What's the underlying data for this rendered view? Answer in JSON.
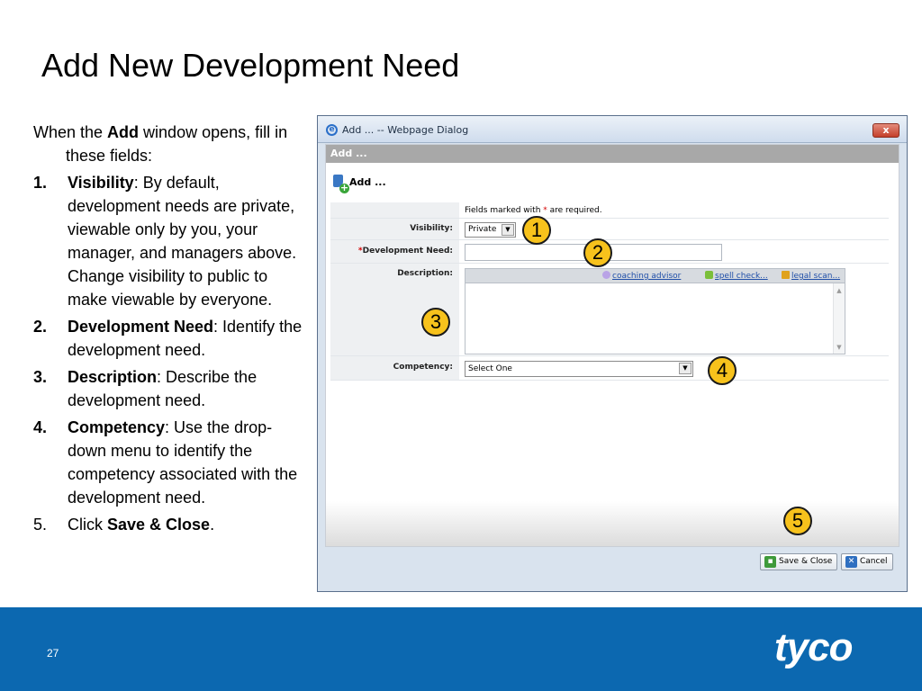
{
  "slide": {
    "title": "Add New Development Need",
    "page_number": "27",
    "logo_text": "tyco"
  },
  "instructions": {
    "intro_prefix": "When the ",
    "intro_bold": "Add",
    "intro_suffix": " window opens, fill in these fields:",
    "steps": [
      {
        "num": "1.",
        "bold": "Visibility",
        "text": ": By default, development needs are private, viewable only by you, your manager, and managers above. Change visibility to public to make viewable by everyone."
      },
      {
        "num": "2.",
        "bold": "Development Need",
        "text": ": Identify the development need."
      },
      {
        "num": "3.",
        "bold": "Description",
        "text": ": Describe the development need."
      },
      {
        "num": "4.",
        "bold": "Competency",
        "text": ": Use the drop-down menu to identify the competency associated with the development need."
      },
      {
        "num": "5.",
        "prefix": "Click ",
        "bold": "Save & Close",
        "suffix": "."
      }
    ]
  },
  "dialog": {
    "title": "Add ... -- Webpage Dialog",
    "close_label": "x",
    "header": "Add ...",
    "heading": "Add ...",
    "required_note_prefix": "Fields marked with ",
    "required_star": "*",
    "required_note_suffix": " are required.",
    "fields": {
      "visibility_label": "Visibility:",
      "visibility_value": "Private",
      "dev_need_star": "*",
      "dev_need_label": "Development Need:",
      "description_label": "Description:",
      "competency_label": "Competency:",
      "competency_value": "Select One"
    },
    "editor_tools": {
      "coaching": "coaching advisor",
      "spell": "spell check...",
      "legal": "legal scan..."
    },
    "buttons": {
      "save": "Save & Close",
      "cancel": "Cancel"
    }
  },
  "callouts": [
    "1",
    "2",
    "3",
    "4",
    "5"
  ],
  "colors": {
    "callout_fill": "#f7c21c",
    "band_blue": "#0c68b0",
    "required_red": "#d40000"
  }
}
